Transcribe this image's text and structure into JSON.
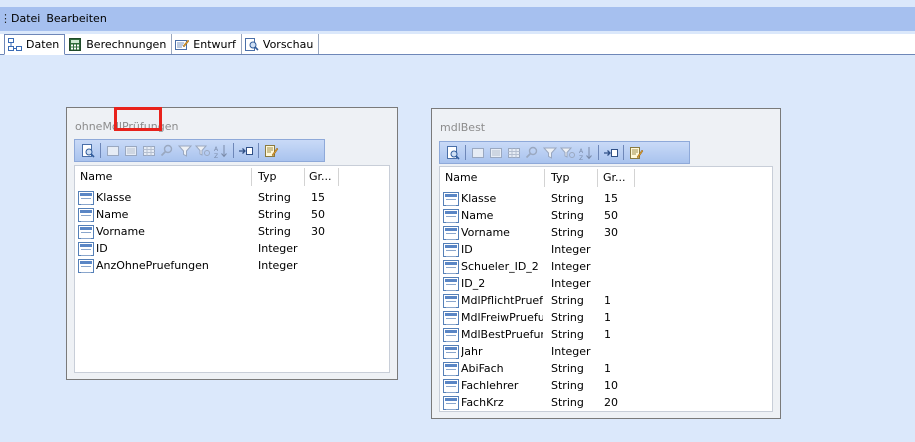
{
  "menu": {
    "items": [
      "Datei",
      "Bearbeiten"
    ]
  },
  "tabs": [
    {
      "label": "Daten",
      "icon": "relations-icon",
      "active": true
    },
    {
      "label": "Berechnungen",
      "icon": "calculator-icon",
      "active": false
    },
    {
      "label": "Entwurf",
      "icon": "design-icon",
      "active": false
    },
    {
      "label": "Vorschau",
      "icon": "preview-icon",
      "active": false
    }
  ],
  "tables": [
    {
      "title": "ohneMdlPrüfungen",
      "columns": {
        "name": "Name",
        "type": "Typ",
        "size": "Gr..."
      },
      "fields": [
        {
          "name": "Klasse",
          "type": "String",
          "size": "15"
        },
        {
          "name": "Name",
          "type": "String",
          "size": "50"
        },
        {
          "name": "Vorname",
          "type": "String",
          "size": "30"
        },
        {
          "name": "ID",
          "type": "Integer",
          "size": ""
        },
        {
          "name": "AnzOhnePruefungen",
          "type": "Integer",
          "size": ""
        }
      ]
    },
    {
      "title": "mdlBest",
      "columns": {
        "name": "Name",
        "type": "Typ",
        "size": "Gr..."
      },
      "fields": [
        {
          "name": "Klasse",
          "type": "String",
          "size": "15"
        },
        {
          "name": "Name",
          "type": "String",
          "size": "50"
        },
        {
          "name": "Vorname",
          "type": "String",
          "size": "30"
        },
        {
          "name": "ID",
          "type": "Integer",
          "size": ""
        },
        {
          "name": "Schueler_ID_2",
          "type": "Integer",
          "size": ""
        },
        {
          "name": "ID_2",
          "type": "Integer",
          "size": ""
        },
        {
          "name": "MdlPflichtPruefung",
          "type": "String",
          "size": "1"
        },
        {
          "name": "MdlFreiwPruefung",
          "type": "String",
          "size": "1"
        },
        {
          "name": "MdlBestPruefung",
          "type": "String",
          "size": "1"
        },
        {
          "name": "Jahr",
          "type": "Integer",
          "size": ""
        },
        {
          "name": "AbiFach",
          "type": "String",
          "size": "1"
        },
        {
          "name": "Fachlehrer",
          "type": "String",
          "size": "10"
        },
        {
          "name": "FachKrz",
          "type": "String",
          "size": "20"
        }
      ]
    }
  ],
  "toolbar_icons": [
    "preview-icon",
    "add-field-icon",
    "properties-icon",
    "grid-icon",
    "search-icon",
    "filter-icon",
    "filter-edit-icon",
    "sort-icon",
    "insert-icon",
    "edit-icon"
  ],
  "colors": {
    "highlight": "#e8221c",
    "menubar": "#a6c0ef",
    "canvas": "#dbe8fb"
  }
}
